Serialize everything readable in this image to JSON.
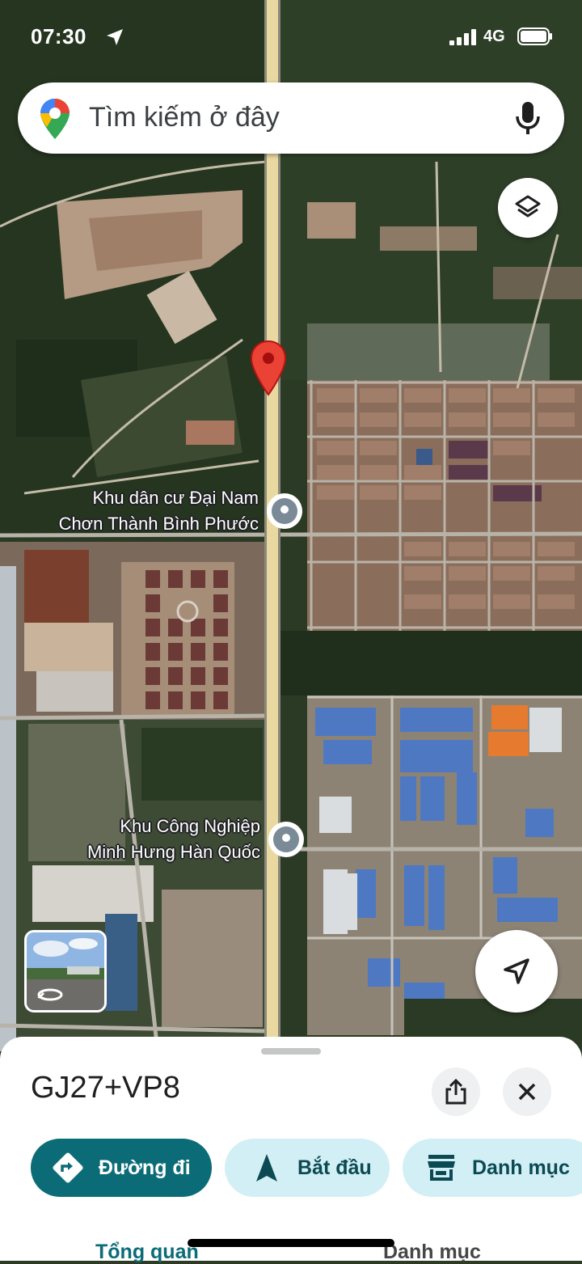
{
  "status_bar": {
    "time": "07:30",
    "network": "4G"
  },
  "search": {
    "placeholder": "Tìm kiếm ở đây",
    "logo_icon": "google-maps-pin-icon",
    "mic_icon": "microphone-icon"
  },
  "map": {
    "labels": [
      {
        "line1": "Khu dân cư Đại Nam",
        "line2": "Chơn Thành Bình Phước"
      },
      {
        "line1": "Khu Công Nghiệp",
        "line2": "Minh Hưng Hàn Quốc"
      }
    ],
    "controls": {
      "layers_icon": "layers-icon",
      "location_icon": "navigation-arrow-icon",
      "street_view_icon": "street-view-rotate-icon"
    },
    "colors": {
      "pin": "#ea4335",
      "road": "#e9d9a0",
      "vegetation": "#24361f"
    }
  },
  "place": {
    "title": "GJ27+VP8",
    "share_icon": "share-icon",
    "close_icon": "close-icon"
  },
  "actions": [
    {
      "label": "Đường đi",
      "icon": "directions-icon"
    },
    {
      "label": "Bắt đầu",
      "icon": "navigation-start-icon"
    },
    {
      "label": "Danh mục",
      "icon": "store-icon"
    }
  ],
  "tabs": [
    {
      "label": "Tổng quan",
      "active": true
    },
    {
      "label": "Danh mục",
      "active": false
    }
  ],
  "accent_color": "#0b6c78"
}
